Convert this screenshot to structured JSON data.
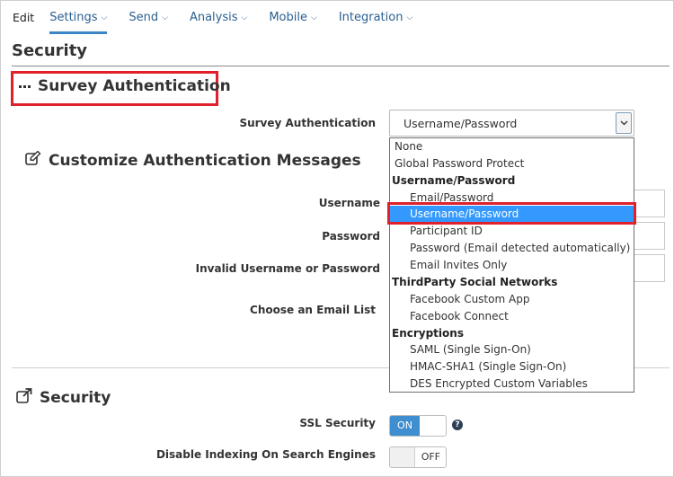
{
  "nav": {
    "items": [
      {
        "label": "Edit"
      },
      {
        "label": "Settings"
      },
      {
        "label": "Send"
      },
      {
        "label": "Analysis"
      },
      {
        "label": "Mobile"
      },
      {
        "label": "Integration"
      }
    ],
    "active": "Settings"
  },
  "page_title": "Security",
  "survey_auth": {
    "heading": "Survey Authentication",
    "field_label": "Survey Authentication",
    "selected_value": "Username/Password",
    "options": [
      {
        "label": "None",
        "kind": "option"
      },
      {
        "label": "Global Password Protect",
        "kind": "option"
      },
      {
        "label": "Username/Password",
        "kind": "group"
      },
      {
        "label": "Email/Password",
        "kind": "sub"
      },
      {
        "label": "Username/Password",
        "kind": "sub",
        "selected": true
      },
      {
        "label": "Participant ID",
        "kind": "sub"
      },
      {
        "label": "Password (Email detected automatically)",
        "kind": "sub"
      },
      {
        "label": "Email Invites Only",
        "kind": "sub"
      },
      {
        "label": "ThirdParty Social Networks",
        "kind": "group"
      },
      {
        "label": "Facebook Custom App",
        "kind": "sub"
      },
      {
        "label": "Facebook Connect",
        "kind": "sub"
      },
      {
        "label": "Encryptions",
        "kind": "group"
      },
      {
        "label": "SAML (Single Sign-On)",
        "kind": "sub"
      },
      {
        "label": "HMAC-SHA1 (Single Sign-On)",
        "kind": "sub"
      },
      {
        "label": "DES Encrypted Custom Variables",
        "kind": "sub"
      }
    ]
  },
  "customize": {
    "heading": "Customize Authentication Messages",
    "username_label": "Username",
    "password_label": "Password",
    "invalid_label": "Invalid Username or Password",
    "email_list_label": "Choose an Email List"
  },
  "security": {
    "heading": "Security",
    "ssl_label": "SSL Security",
    "ssl_state": "ON",
    "indexing_label": "Disable Indexing On Search Engines",
    "indexing_state": "OFF"
  },
  "colors": {
    "accent": "#3b86c6",
    "highlight": "#e0202b",
    "selected_option": "#3399ff",
    "toggle_on": "#3e8ed0"
  },
  "icons": {
    "nav_chevron": "chevron-down-icon",
    "survey_auth": "ellipsis-icon",
    "customize": "edit-icon",
    "security": "external-link-icon",
    "help": "help-icon"
  }
}
